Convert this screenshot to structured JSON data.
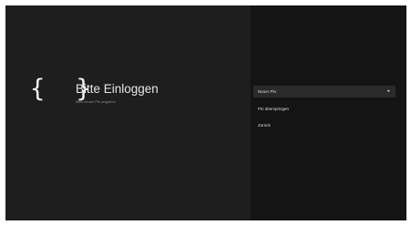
{
  "login": {
    "icon_name": "braces-icon",
    "icon_text": "{ }",
    "title": "Bitte Einloggen",
    "subtitle": "Bitte neuen Pin angeben"
  },
  "menu": {
    "items": [
      {
        "label": "Neuer Pin",
        "chevron": "▸"
      },
      {
        "label": "Pin überspringen"
      },
      {
        "label": "Zurück"
      }
    ]
  },
  "colors": {
    "left_panel": "#1e1e1e",
    "right_panel": "#141414",
    "highlight": "#2a2a2a",
    "text": "#e6e6e6"
  }
}
